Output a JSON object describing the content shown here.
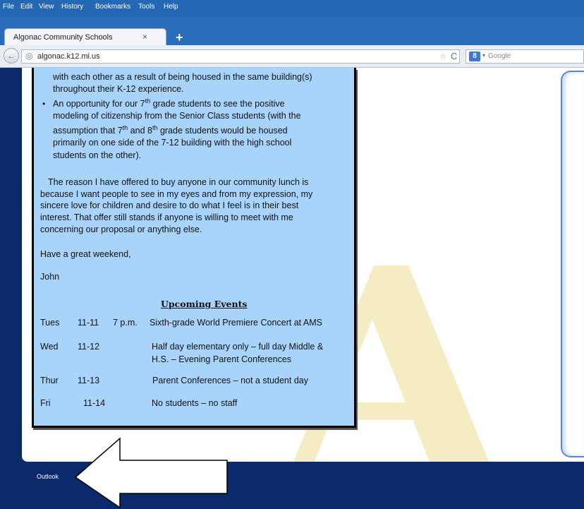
{
  "menu": [
    "File",
    "Edit",
    "View",
    "History",
    "Bookmarks",
    "Tools",
    "Help"
  ],
  "tab": {
    "title": "Algonac Community Schools",
    "close": "×",
    "new_tab": "+"
  },
  "nav": {
    "back": "←",
    "globe": "◎",
    "url": "algonac.k12.mi.us",
    "star": "☆",
    "reload": "C",
    "search_badge": "8",
    "search_caret": "▾",
    "search_placeholder": "Google"
  },
  "watermark": "A",
  "letter": {
    "bullets": [
      {
        "lines": [
          {
            "parts": [
              "with each other as a result of being housed in the same building(s)"
            ]
          },
          {
            "parts": [
              "throughout their K-12 experience."
            ]
          }
        ]
      },
      {
        "lines": [
          {
            "parts": [
              "An opportunity for our 7",
              "th",
              " grade students to see the positive"
            ]
          },
          {
            "parts": [
              "modeling of citizenship from the Senior Class students (with the"
            ]
          },
          {
            "parts": [
              "assumption that 7",
              "th",
              " and 8",
              "th",
              " grade students would be housed"
            ]
          },
          {
            "parts": [
              "primarily on one side of the 7-12 building with the high school"
            ]
          },
          {
            "parts": [
              "students on the other)."
            ]
          }
        ]
      }
    ],
    "paragraph": [
      "The reason I have offered to buy anyone in our community lunch is",
      "because I want people to see in my eyes and from my expression, my",
      "sincere love for children and desire to do what I feel is in their best",
      "interest.  That offer still stands if anyone is willing to meet with me",
      "concerning our proposal or anything else."
    ],
    "closing": "Have a great weekend,",
    "signature": "John",
    "events_title": "Upcoming Events",
    "events": [
      {
        "day": "Tues",
        "date": "11-11",
        "time": "7 p.m.",
        "desc": [
          "Sixth-grade World Premiere Concert at AMS"
        ]
      },
      {
        "day": "Wed",
        "date": "11-12",
        "time": "",
        "desc": [
          "Half day elementary only – full day Middle &",
          "H.S. – Evening Parent Conferences"
        ]
      },
      {
        "day": "Thur",
        "date": "11-13",
        "time": "",
        "desc": [
          "Parent Conferences – not a student day"
        ]
      },
      {
        "day": "Fri",
        "date": "11-14",
        "time": "",
        "desc": [
          "No students – no staff"
        ]
      }
    ]
  },
  "footer": {
    "outlook": "Outlook"
  },
  "colors": {
    "chrome_blue": "#2467b3",
    "page_navy": "#0b2a6b",
    "letter_bg": "#a8d3fb",
    "watermark": "#f6ecc4"
  },
  "icons": [
    "back-arrow-icon",
    "globe-icon",
    "star-icon",
    "reload-icon",
    "google-search-icon",
    "close-icon",
    "plus-icon",
    "arrow-pointer-icon"
  ]
}
